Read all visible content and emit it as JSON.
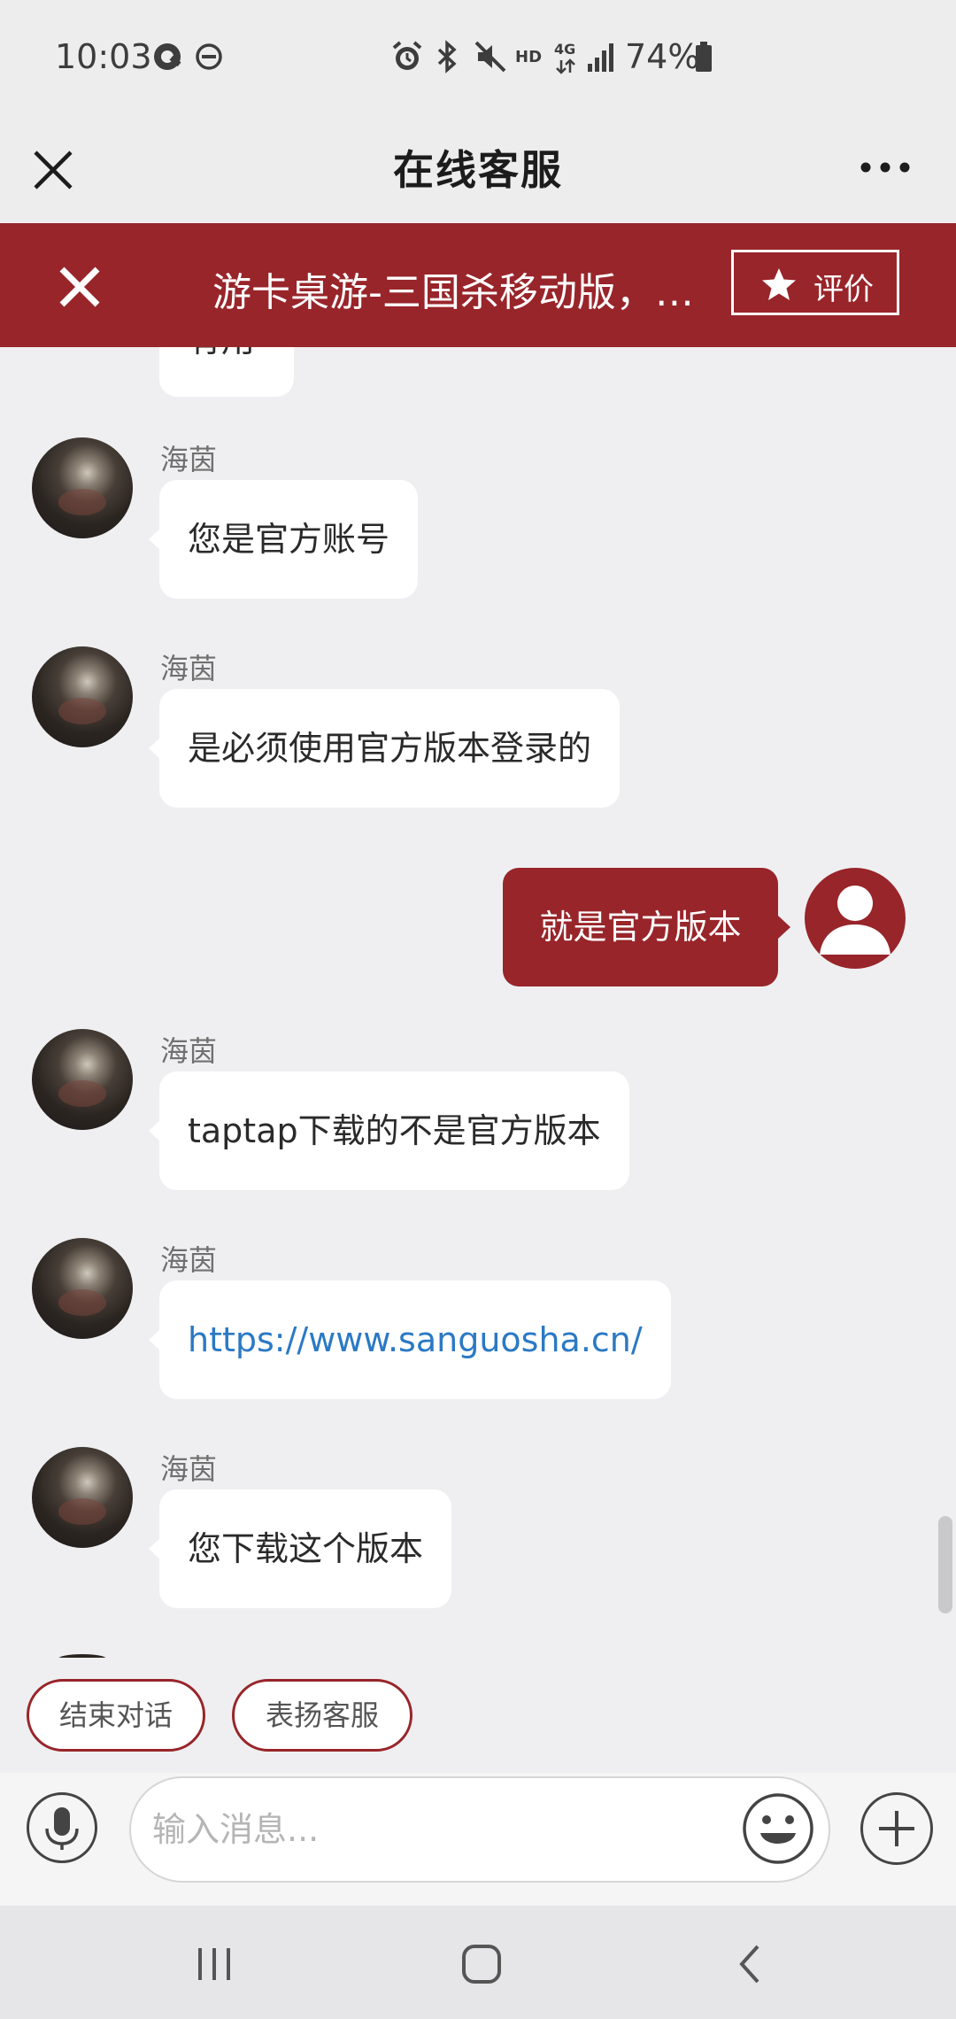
{
  "status_bar": {
    "time": "10:03",
    "battery": "74%",
    "hd_label": "HD",
    "network_label": "4G",
    "icons": [
      "q-app-icon",
      "dnd-icon",
      "alarm-icon",
      "bluetooth-icon",
      "mute-icon",
      "signal-icon",
      "battery-icon"
    ]
  },
  "header": {
    "title": "在线客服",
    "close_icon": "close-icon",
    "more_icon": "more-options-icon"
  },
  "banner": {
    "title": "游卡桌游-三国杀移动版，全...",
    "rate_label": "评价",
    "rate_icon": "star-icon",
    "close_icon": "close-icon",
    "color": "#98252a"
  },
  "chat": {
    "partial_top_text": "有用",
    "messages": [
      {
        "sender": "海茵",
        "text": "您是官方账号",
        "is_user": false
      },
      {
        "sender": "海茵",
        "text": "是必须使用官方版本登录的",
        "is_user": false
      },
      {
        "sender": "",
        "text": "就是官方版本",
        "is_user": true
      },
      {
        "sender": "海茵",
        "text": "taptap下载的不是官方版本",
        "is_user": false
      },
      {
        "sender": "海茵",
        "text": "https://www.sanguosha.cn/",
        "is_user": false,
        "is_link": true
      },
      {
        "sender": "海茵",
        "text": "您下载这个版本",
        "is_user": false
      }
    ]
  },
  "quick_replies": [
    "结束对话",
    "表扬客服"
  ],
  "input": {
    "placeholder": "输入消息...",
    "value": ""
  },
  "nav": {
    "icons": [
      "recent-apps-icon",
      "home-icon",
      "back-icon"
    ]
  },
  "colors": {
    "accent": "#98252a",
    "link": "#2b79c4",
    "background": "#efeff1",
    "bubble": "#ffffff"
  }
}
